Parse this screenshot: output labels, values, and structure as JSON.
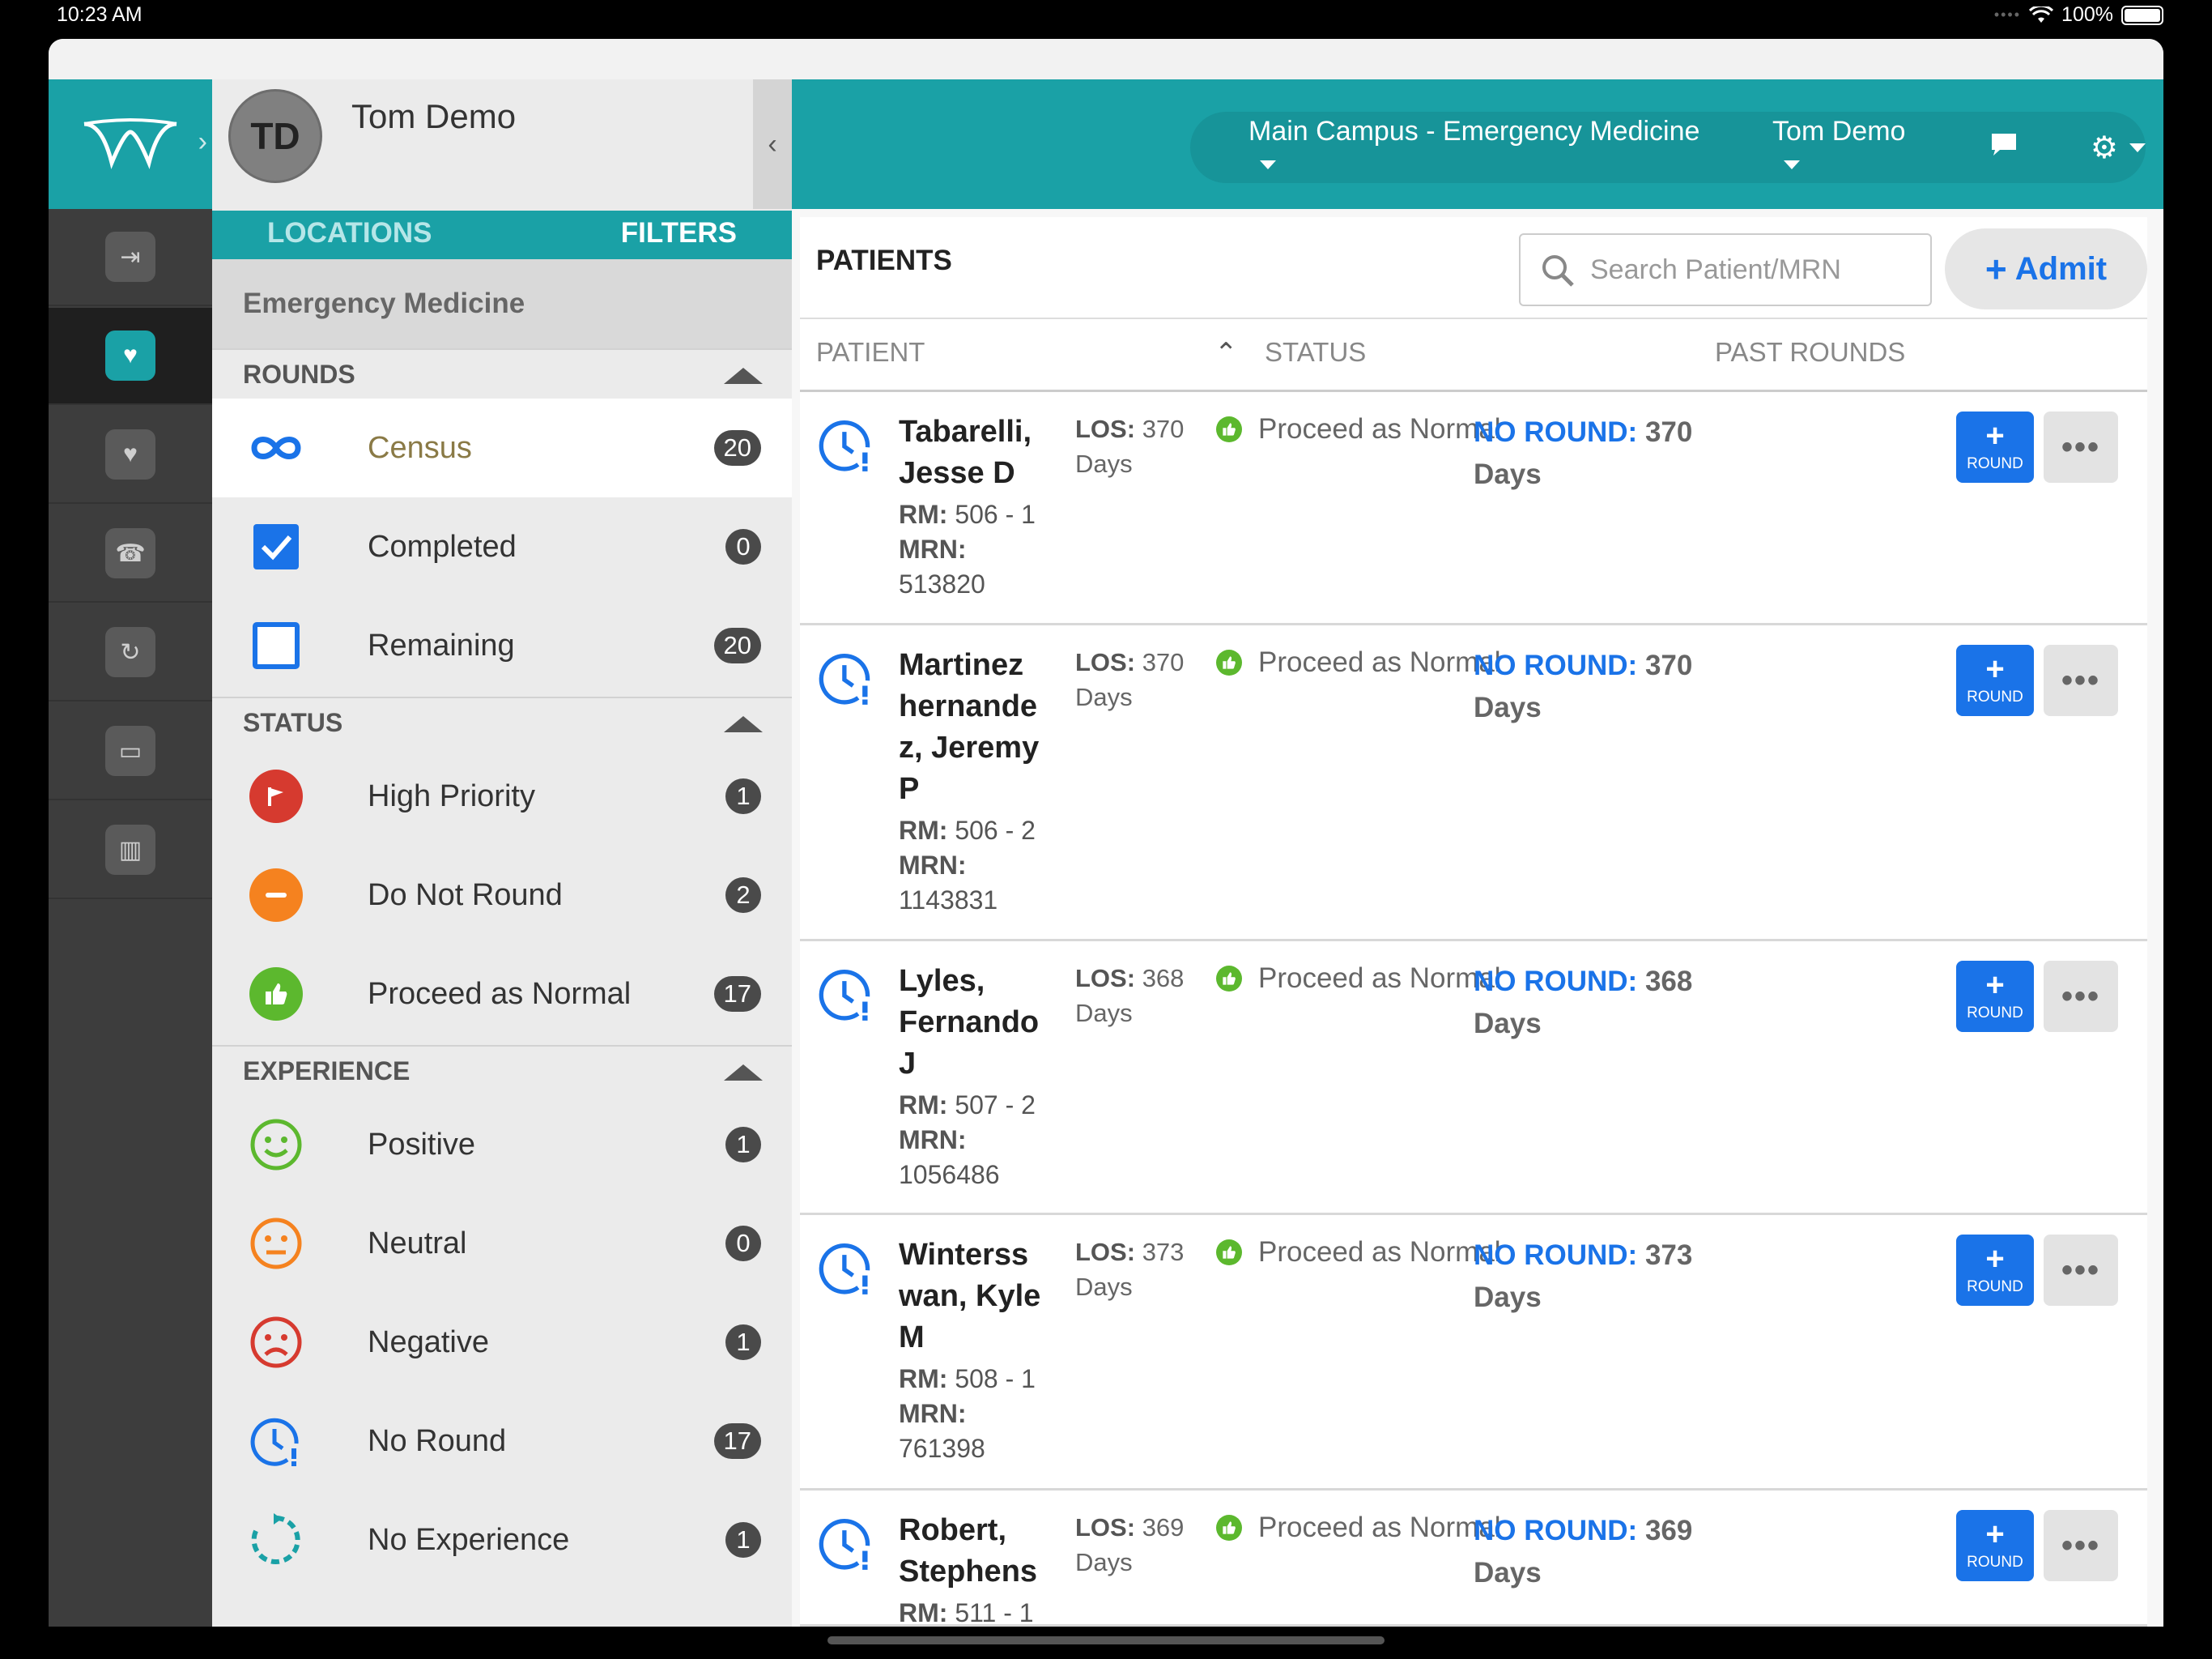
{
  "status_bar": {
    "time": "10:23 AM",
    "battery": "100%"
  },
  "rail": {
    "items": [
      "logout-icon",
      "rounding-icon",
      "message-icon",
      "heart-phone-icon",
      "refresh-user-icon",
      "bed-search-icon",
      "analytics-icon"
    ]
  },
  "user": {
    "initials": "TD",
    "name": "Tom Demo"
  },
  "side_tabs": {
    "locations": "LOCATIONS",
    "filters": "FILTERS"
  },
  "unit": "Emergency Medicine",
  "sections": {
    "rounds": "ROUNDS",
    "status": "STATUS",
    "experience": "EXPERIENCE"
  },
  "rounds": [
    {
      "label": "Census",
      "count": "20",
      "icon": "infinity-icon"
    },
    {
      "label": "Completed",
      "count": "0",
      "icon": "checkbox-checked-icon"
    },
    {
      "label": "Remaining",
      "count": "20",
      "icon": "checkbox-empty-icon"
    }
  ],
  "status": [
    {
      "label": "High Priority",
      "count": "1",
      "color": "#d63a2f",
      "icon": "flag-icon"
    },
    {
      "label": "Do Not Round",
      "count": "2",
      "color": "#f5821f",
      "icon": "minus-icon"
    },
    {
      "label": "Proceed as Normal",
      "count": "17",
      "color": "#5cb82e",
      "icon": "thumbs-up-icon"
    }
  ],
  "experience": [
    {
      "label": "Positive",
      "count": "1",
      "color": "#5cb82e",
      "icon": "smile-icon"
    },
    {
      "label": "Neutral",
      "count": "0",
      "color": "#f5821f",
      "icon": "neutral-face-icon"
    },
    {
      "label": "Negative",
      "count": "1",
      "color": "#d63a2f",
      "icon": "frown-icon"
    },
    {
      "label": "No Round",
      "count": "17",
      "color": "#1a73e8",
      "icon": "clock-alert-icon"
    },
    {
      "label": "No Experience",
      "count": "1",
      "color": "#1aa1a6",
      "icon": "dashed-refresh-icon"
    }
  ],
  "topbar": {
    "location": "Main Campus - Emergency Medicine",
    "user": "Tom Demo"
  },
  "patients": {
    "title": "PATIENTS",
    "search_placeholder": "Search Patient/MRN",
    "admit_label": "Admit",
    "columns": {
      "patient": "PATIENT",
      "status": "STATUS",
      "past_rounds": "PAST ROUNDS"
    },
    "rm_label": "RM:",
    "mrn_label": "MRN:",
    "los_label": "LOS:",
    "days": "Days",
    "no_round_label": "NO ROUND:",
    "round_label": "ROUND",
    "rows": [
      {
        "name_lines": [
          "Tabarelli,",
          "Jesse D"
        ],
        "rm": "506 - 1",
        "mrn": "513820",
        "los": "370",
        "status": "Proceed as Normal",
        "past": "370"
      },
      {
        "name_lines": [
          "Martinez",
          "hernande",
          "z, Jeremy",
          "P"
        ],
        "rm": "506 - 2",
        "mrn": "1143831",
        "los": "370",
        "status": "Proceed as Normal",
        "past": "370"
      },
      {
        "name_lines": [
          "Lyles,",
          "Fernando",
          "J"
        ],
        "rm": "507 - 2",
        "mrn": "1056486",
        "los": "368",
        "status": "Proceed as Normal",
        "past": "368"
      },
      {
        "name_lines": [
          "Winterss",
          "wan, Kyle",
          "M"
        ],
        "rm": "508 - 1",
        "mrn": "761398",
        "los": "373",
        "status": "Proceed as Normal",
        "past": "373"
      },
      {
        "name_lines": [
          "Robert,",
          "Stephens"
        ],
        "rm": "511 - 1",
        "mrn": "",
        "los": "369",
        "status": "Proceed as Normal",
        "past": "369"
      }
    ]
  }
}
